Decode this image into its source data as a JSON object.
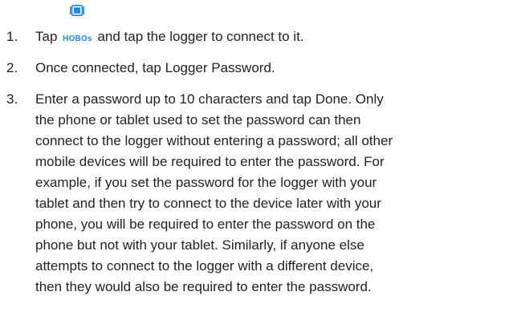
{
  "steps": [
    {
      "number": "1.",
      "before": "Tap",
      "button_label": "HOBOs",
      "button_icon": "logger-device-icon",
      "after": "and tap the logger to connect to it."
    },
    {
      "number": "2.",
      "lines": [
        "Once connected, tap Logger Password."
      ]
    },
    {
      "number": "3.",
      "lines": [
        "Enter a password up to 10 characters and tap Done. Only",
        "the phone or tablet used to set the password can then",
        "connect to the logger without entering a password; all other",
        "mobile devices will be required to enter the password. For",
        "example, if you set the password for the logger with your",
        "tablet and then try to connect to the device later with your",
        "phone, you will be required to enter the password on the",
        "phone but not with your tablet. Similarly, if anyone else",
        "attempts to connect to the logger with a different device,",
        "then they would also be required to enter the password."
      ]
    }
  ],
  "colors": {
    "text": "#222222",
    "accent": "#1e88e5"
  }
}
